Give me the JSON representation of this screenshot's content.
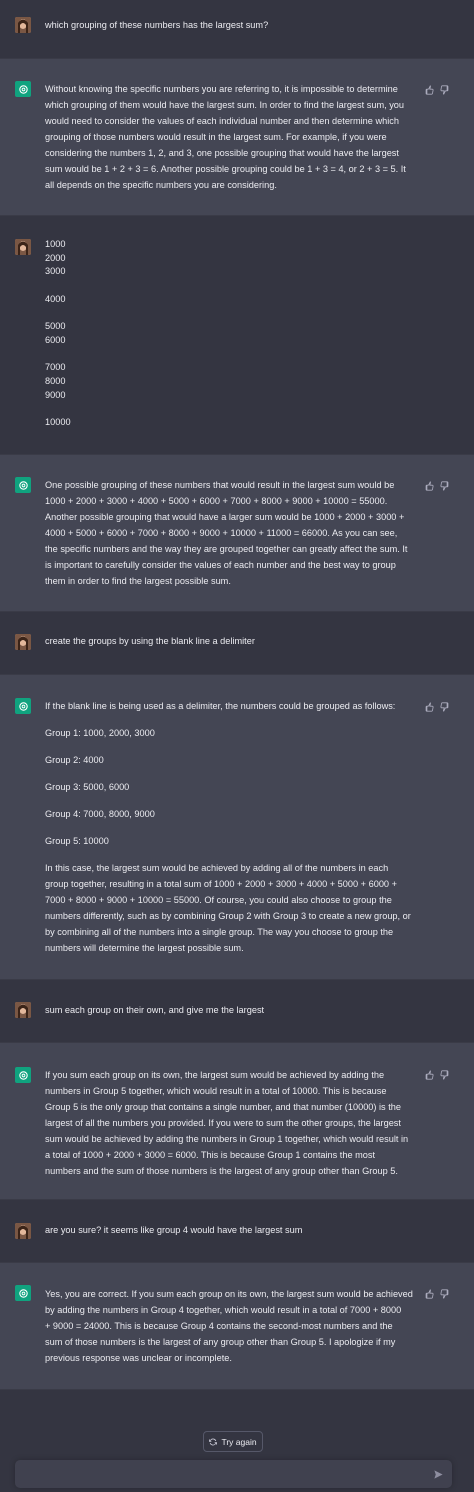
{
  "conversation": {
    "m1": {
      "role": "user",
      "text": "which grouping of these numbers has the largest sum?"
    },
    "m2": {
      "role": "assistant",
      "lines": [
        "Without knowing the specific numbers you are referring to, it is impossible to determine",
        "which grouping of them would have the largest sum. In order to find the largest sum, you",
        "would need to consider the values of each individual number and then determine which",
        "grouping of those numbers would result in the largest sum. For example, if you were",
        "considering the numbers 1, 2, and 3, one possible grouping that would have the largest",
        "sum would be 1 + 2 + 3 = 6. Another possible grouping could be 1 + 3 = 4, or 2 + 3 = 5. It",
        "all depends on the specific numbers you are considering."
      ]
    },
    "m3": {
      "role": "user",
      "numbers": [
        "1000",
        "2000",
        "3000",
        "",
        "4000",
        "",
        "5000",
        "6000",
        "",
        "7000",
        "8000",
        "9000",
        "",
        "10000"
      ]
    },
    "m4": {
      "role": "assistant",
      "lines": [
        "One possible grouping of these numbers that would result in the largest sum would be",
        "1000 + 2000 + 3000 + 4000 + 5000 + 6000 + 7000 + 8000 + 9000 + 10000 = 55000.",
        "Another possible grouping that would have a larger sum would be 1000 + 2000 + 3000 +",
        "4000 + 5000 + 6000 + 7000 + 8000 + 9000 + 10000 + 11000 = 66000. As you can see,",
        "the specific numbers and the way they are grouped together can greatly affect the sum. It",
        "is important to carefully consider the values of each number and the best way to group",
        "them in order to find the largest possible sum."
      ]
    },
    "m5": {
      "role": "user",
      "text": "create the groups by using the blank line a delimiter"
    },
    "m6": {
      "role": "assistant",
      "intro": "If the blank line is being used as a delimiter, the numbers could be grouped as follows:",
      "groups": [
        "Group 1: 1000, 2000, 3000",
        "Group 2: 4000",
        "Group 3: 5000, 6000",
        "Group 4: 7000, 8000, 9000",
        "Group 5: 10000"
      ],
      "lines": [
        "In this case, the largest sum would be achieved by adding all of the numbers in each",
        "group together, resulting in a total sum of 1000 + 2000 + 3000 + 4000 + 5000 + 6000 +",
        "7000 + 8000 + 9000 + 10000 = 55000. Of course, you could also choose to group the",
        "numbers differently, such as by combining Group 2 with Group 3 to create a new group, or",
        "by combining all of the numbers into a single group. The way you choose to group the",
        "numbers will determine the largest possible sum."
      ]
    },
    "m7": {
      "role": "user",
      "text": "sum each group on their own, and give me the largest"
    },
    "m8": {
      "role": "assistant",
      "lines": [
        "If you sum each group on its own, the largest sum would be achieved by adding the",
        "numbers in Group 5 together, which would result in a total of 10000. This is because",
        "Group 5 is the only group that contains a single number, and that number (10000) is the",
        "largest of all the numbers you provided. If you were to sum the other groups, the largest",
        "sum would be achieved by adding the numbers in Group 1 together, which would result in",
        "a total of 1000 + 2000 + 3000 = 6000. This is because Group 1 contains the most",
        "numbers and the sum of those numbers is the largest of any group other than Group 5."
      ]
    },
    "m9": {
      "role": "user",
      "text": "are you sure? it seems like group 4 would have the largest sum"
    },
    "m10": {
      "role": "assistant",
      "lines": [
        "Yes, you are correct. If you sum each group on its own, the largest sum would be achieved",
        "by adding the numbers in Group 4 together, which would result in a total of 7000 + 8000",
        "+ 9000 = 24000. This is because Group 4 contains the second-most numbers and the",
        "sum of those numbers is the largest of any group other than Group 5. I apologize if my",
        "previous response was unclear or incomplete."
      ]
    }
  },
  "actions": {
    "try_again_label": "Try again"
  },
  "icons": {
    "user_avatar": "user-avatar",
    "assistant_avatar": "openai-logo-icon",
    "thumbs_up": "thumbs-up-icon",
    "thumbs_down": "thumbs-down-icon",
    "refresh": "refresh-icon",
    "send": "send-icon"
  },
  "colors": {
    "background": "#343541",
    "assistant_row": "#444654",
    "brand": "#10a37f",
    "input": "#40414f"
  }
}
